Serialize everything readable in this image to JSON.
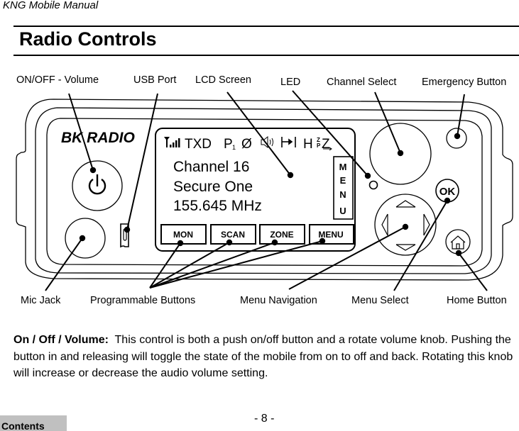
{
  "header": {
    "title": "KNG Mobile Manual"
  },
  "section": {
    "title": "Radio Controls"
  },
  "diagram": {
    "brand": "BK RADIO",
    "callouts_top": [
      {
        "id": "on-off-volume",
        "label": "ON/OFF - Volume"
      },
      {
        "id": "usb-port",
        "label": "USB Port"
      },
      {
        "id": "lcd-screen",
        "label": "LCD Screen"
      },
      {
        "id": "led",
        "label": "LED"
      },
      {
        "id": "channel-select",
        "label": "Channel Select"
      },
      {
        "id": "emergency-button",
        "label": "Emergency Button"
      }
    ],
    "callouts_bottom": [
      {
        "id": "mic-jack",
        "label": "Mic Jack"
      },
      {
        "id": "programmable-buttons",
        "label": "Programmable Buttons"
      },
      {
        "id": "menu-navigation",
        "label": "Menu Navigation"
      },
      {
        "id": "menu-select",
        "label": "Menu Select"
      },
      {
        "id": "home-button",
        "label": "Home Button"
      }
    ],
    "lcd": {
      "status_icons": [
        "signal-strength-icon",
        "TXD",
        "P1",
        "Ø",
        "speaker-icon",
        "scan-bar-icon",
        "H",
        "zone-icon"
      ],
      "txd": "TXD",
      "power_letter": "P",
      "power_sub": "1",
      "null_symbol": "Ø",
      "h_letter": "H",
      "zone_top": "Z",
      "zone_bottom": "P",
      "zone_main": "Z",
      "lines": [
        "Channel 16",
        "Secure One",
        "155.645 MHz"
      ],
      "side_menu_letters": [
        "M",
        "E",
        "N",
        "U"
      ]
    },
    "soft_keys": [
      "MON",
      "SCAN",
      "ZONE",
      "MENU"
    ],
    "ok_label": "OK"
  },
  "body_text": {
    "heading": "On / Off / Volume:",
    "text": "This control is both a push on/off button and a rotate volume knob. Pushing the button in and releasing will toggle the state of the mobile from on to off and back. Rotating this knob will increase or decrease the audio volume setting."
  },
  "footer": {
    "contents_label": "Contents",
    "page_number": "- 8 -"
  }
}
